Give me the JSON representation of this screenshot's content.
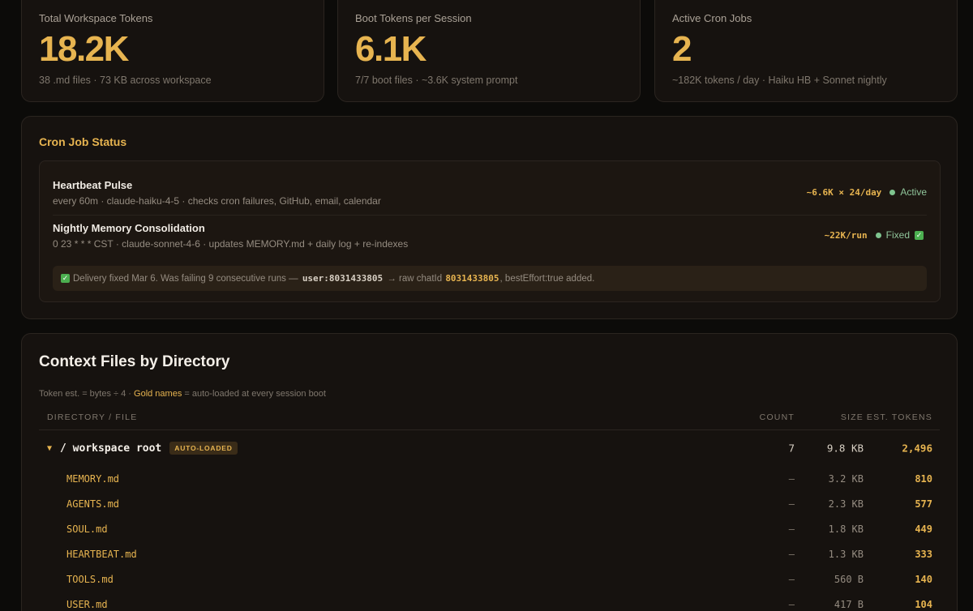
{
  "stats": [
    {
      "label": "Total Workspace Tokens",
      "value": "18.2K",
      "sub": "38 .md files · 73 KB across workspace"
    },
    {
      "label": "Boot Tokens per Session",
      "value": "6.1K",
      "sub": "7/7 boot files · ~3.6K system prompt"
    },
    {
      "label": "Active Cron Jobs",
      "value": "2",
      "sub": "~182K tokens / day · Haiku HB + Sonnet nightly"
    }
  ],
  "cron": {
    "title": "Cron Job Status",
    "jobs": [
      {
        "name": "Heartbeat Pulse",
        "desc": "every 60m · claude-haiku-4-5 · checks cron failures, GitHub, email, calendar",
        "rate": "~6.6K × 24/day",
        "status": "Active"
      },
      {
        "name": "Nightly Memory Consolidation",
        "desc": "0 23 * * * CST · claude-sonnet-4-6 · updates MEMORY.md + daily log + re-indexes",
        "rate": "~22K/run",
        "status": "Fixed"
      }
    ],
    "note": {
      "check": "✓",
      "part1": "Delivery fixed Mar 6. Was failing 9 consecutive runs —",
      "code1": "user:8031433805",
      "part2": "→ raw chatId",
      "code2": "8031433805",
      "part3": ", bestEffort:true added."
    },
    "colors": {
      "accent": "#e7b450",
      "active": "#7fc48f"
    }
  },
  "context": {
    "title": "Context Files by Directory",
    "hint_prefix": "Token est. = bytes ÷ 4 ·",
    "hint_gold": "Gold names",
    "hint_suffix": "= auto-loaded at every session boot",
    "columns": {
      "file": "DIRECTORY / FILE",
      "count": "COUNT",
      "size": "SIZE",
      "tokens": "EST. TOKENS"
    },
    "root": {
      "name": "/ workspace root",
      "badge": "AUTO-LOADED",
      "count": "7",
      "size": "9.8 KB",
      "tokens": "2,496"
    },
    "files": [
      {
        "name": "MEMORY.md",
        "count": "—",
        "size": "3.2 KB",
        "tokens": "810"
      },
      {
        "name": "AGENTS.md",
        "count": "—",
        "size": "2.3 KB",
        "tokens": "577"
      },
      {
        "name": "SOUL.md",
        "count": "—",
        "size": "1.8 KB",
        "tokens": "449"
      },
      {
        "name": "HEARTBEAT.md",
        "count": "—",
        "size": "1.3 KB",
        "tokens": "333"
      },
      {
        "name": "TOOLS.md",
        "count": "—",
        "size": "560 B",
        "tokens": "140"
      },
      {
        "name": "USER.md",
        "count": "—",
        "size": "417 B",
        "tokens": "104"
      }
    ]
  }
}
